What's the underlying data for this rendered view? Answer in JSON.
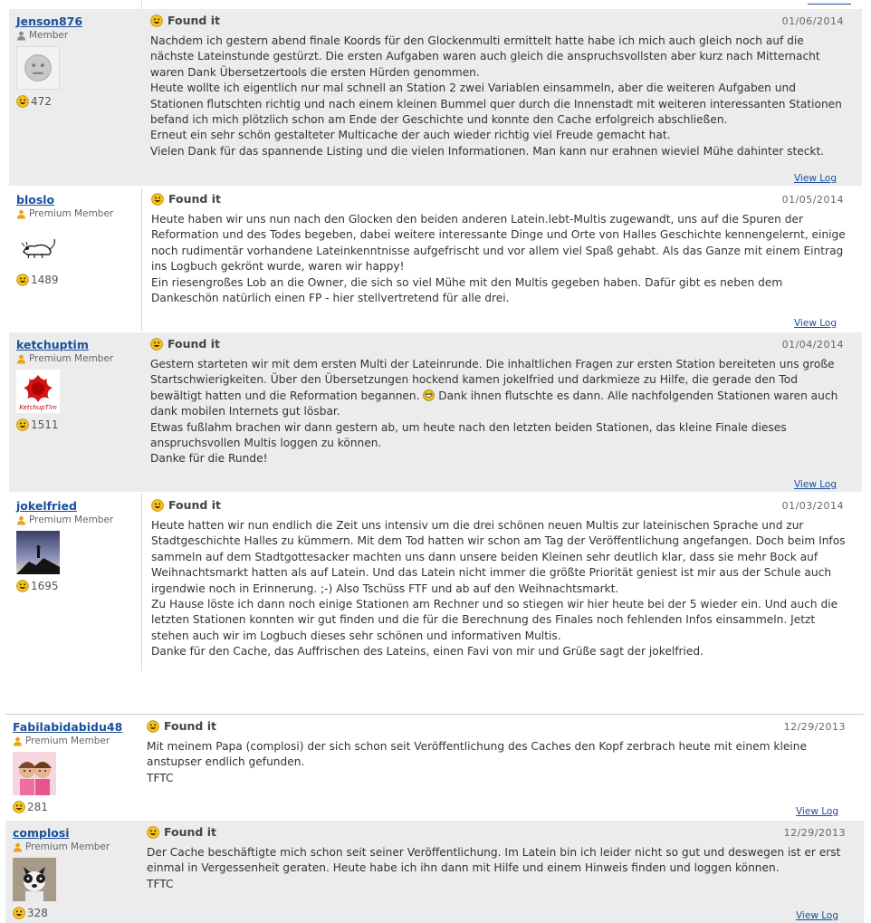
{
  "colors": {
    "link": "#1a4f9c",
    "shaded": "#ececec",
    "text": "#333333"
  },
  "logs": [
    {
      "username": "Jenson876",
      "member_type": "Member",
      "member_icon": "member-gray-icon",
      "avatar": "gray-face-avatar",
      "finds": "472",
      "log_type": "Found it",
      "date": "01/06/2014",
      "text": [
        "Nachdem ich gestern abend finale Koords für den Glockenmulti ermittelt hatte habe ich mich auch gleich noch auf die nächste Lateinstunde gestürzt. Die ersten Aufgaben waren auch gleich die anspruchsvollsten aber kurz nach Mitternacht waren Dank Übersetzertools die ersten Hürden genommen.",
        "Heute wollte ich eigentlich nur mal schnell an Station 2 zwei Variablen einsammeln, aber die weiteren Aufgaben und Stationen flutschten richtig und nach einem kleinen Bummel quer durch die Innenstadt mit weiteren interessanten Stationen befand ich mich plötzlich schon am Ende der Geschichte und konnte den Cache erfolgreich abschließen.",
        "Erneut ein sehr schön gestalteter Multicache der auch wieder richtig viel Freude gemacht hat.",
        "Vielen Dank für das spannende Listing und die vielen Informationen. Man kann nur erahnen wieviel Mühe dahinter steckt."
      ],
      "view_log": "View Log"
    },
    {
      "username": "bloslo",
      "member_type": "Premium Member",
      "member_icon": "premium-member-icon",
      "avatar": "rat-sketch-avatar",
      "finds": "1489",
      "log_type": "Found it",
      "date": "01/05/2014",
      "text": [
        "Heute haben wir uns nun nach den Glocken den beiden anderen Latein.lebt-Multis zugewandt, uns auf die Spuren der Reformation und des Todes begeben, dabei weitere interessante Dinge und Orte von Halles Geschichte kennengelernt, einige noch rudimentär vorhandene Lateinkenntnisse aufgefrischt und vor allem viel Spaß gehabt. Als das Ganze mit einem Eintrag ins Logbuch gekrönt wurde, waren wir happy!",
        "Ein riesengroßes Lob an die Owner, die sich so viel Mühe mit den Multis gegeben haben. Dafür gibt es neben dem Dankeschön natürlich einen FP - hier stellvertretend für alle drei."
      ],
      "view_log": "View Log"
    },
    {
      "username": "ketchuptim",
      "member_type": "Premium Member",
      "member_icon": "premium-member-icon",
      "avatar": "ketchup-splash-avatar",
      "finds": "1511",
      "log_type": "Found it",
      "date": "01/04/2014",
      "text_a": "Gestern starteten wir mit dem ersten Multi der Lateinrunde. Die inhaltlichen Fragen zur ersten Station bereiteten uns große Startschwierigkeiten. Über den Übersetzungen hockend kamen jokelfried und darkmieze zu Hilfe, die gerade den Tod bewältigt hatten und die Reformation begannen.",
      "text_b": " Dank ihnen flutschte es dann. Alle nachfolgenden Stationen waren auch dank mobilen Internets gut lösbar.",
      "text_c": "Etwas fußlahm brachen wir dann gestern ab, um heute nach den letzten beiden Stationen, das kleine Finale dieses anspruchsvollen Multis loggen zu können.",
      "text_d": "Danke für die Runde!",
      "inline_icon": "big-grin-icon",
      "view_log": "View Log"
    },
    {
      "username": "jokelfried",
      "member_type": "Premium Member",
      "member_icon": "premium-member-icon",
      "avatar": "summit-silhouette-avatar",
      "finds": "1695",
      "log_type": "Found it",
      "date": "01/03/2014",
      "text": [
        "Heute hatten wir nun endlich die Zeit uns intensiv um die drei schönen neuen Multis zur lateinischen Sprache und zur Stadtgeschichte Halles zu kümmern. Mit dem Tod hatten wir schon am Tag der Veröffentlichung angefangen. Doch beim Infos sammeln auf dem Stadtgottesacker machten uns dann unsere beiden Kleinen sehr deutlich klar, dass sie mehr Bock auf Weihnachtsmarkt hatten als auf Latein. Und das Latein nicht immer die größte Priorität geniest ist mir aus der Schule auch irgendwie noch in Erinnerung. ;-) Also Tschüss FTF und ab auf den Weihnachtsmarkt.",
        "Zu Hause löste ich dann noch einige Stationen am Rechner und so stiegen wir hier heute bei der 5 wieder ein. Und auch die letzten Stationen konnten wir gut finden und die für die Berechnung des Finales noch fehlenden Infos einsammeln. Jetzt stehen auch wir im Logbuch dieses sehr schönen und informativen Multis.",
        "Danke für den Cache, das Auffrischen des Lateins, einen Favi von mir und Grüße sagt der jokelfried."
      ]
    },
    {
      "username": "Fabilabidabidu48",
      "member_type": "Premium Member",
      "member_icon": "premium-member-icon",
      "avatar": "two-girls-avatar",
      "finds": "281",
      "log_type": "Found it",
      "date": "12/29/2013",
      "text": [
        "Mit meinem Papa (complosi) der sich schon seit Veröffentlichung des Caches den Kopf zerbrach heute mit einem kleine anstupser endlich gefunden.",
        "TFTC"
      ],
      "view_log": "View Log"
    },
    {
      "username": "complosi",
      "member_type": "Premium Member",
      "member_icon": "premium-member-icon",
      "avatar": "french-bulldog-avatar",
      "finds": "328",
      "log_type": "Found it",
      "date": "12/29/2013",
      "text": [
        "Der Cache beschäftigte mich schon seit seiner Veröffentlichung. Im Latein bin ich leider nicht so gut und deswegen ist er erst einmal in Vergessenheit geraten. Heute habe ich ihn dann mit Hilfe und einem Hinweis finden und loggen können.",
        "TFTC"
      ],
      "view_log": "View Log"
    }
  ]
}
